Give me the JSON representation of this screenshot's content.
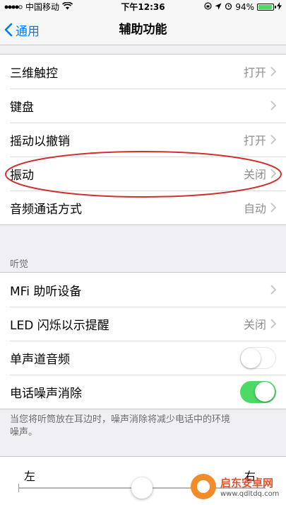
{
  "status_bar": {
    "carrier": "中国移动",
    "time": "下午12:36",
    "battery_text": "94%",
    "battery_level": 0.94,
    "colors": {
      "battery": "#4cd964"
    }
  },
  "nav": {
    "back_label": "通用",
    "title": "辅助功能",
    "accent": "#007aff"
  },
  "group1": [
    {
      "label": "三维触控",
      "value": "打开"
    },
    {
      "label": "键盘",
      "value": ""
    },
    {
      "label": "摇动以撤销",
      "value": "打开"
    },
    {
      "label": "振动",
      "value": "关闭"
    },
    {
      "label": "音频通话方式",
      "value": "自动"
    }
  ],
  "hearing": {
    "header": "听觉",
    "rows": [
      {
        "label": "MFi 助听设备",
        "value": ""
      },
      {
        "label": "LED 闪烁以示提醒",
        "value": "关闭"
      }
    ],
    "toggles": [
      {
        "label": "单声道音频",
        "state": "off"
      },
      {
        "label": "电话噪声消除",
        "state": "on"
      }
    ],
    "footer": "当您将听筒放在耳边时，噪声消除将减少电话中的环境噪声。"
  },
  "balance": {
    "left_label": "左",
    "right_label": "右",
    "position": 0.5
  },
  "watermark": {
    "name": "启东安卓网",
    "url": "www.qdltdq.com"
  },
  "annotation": {
    "color": "#d0312d"
  }
}
